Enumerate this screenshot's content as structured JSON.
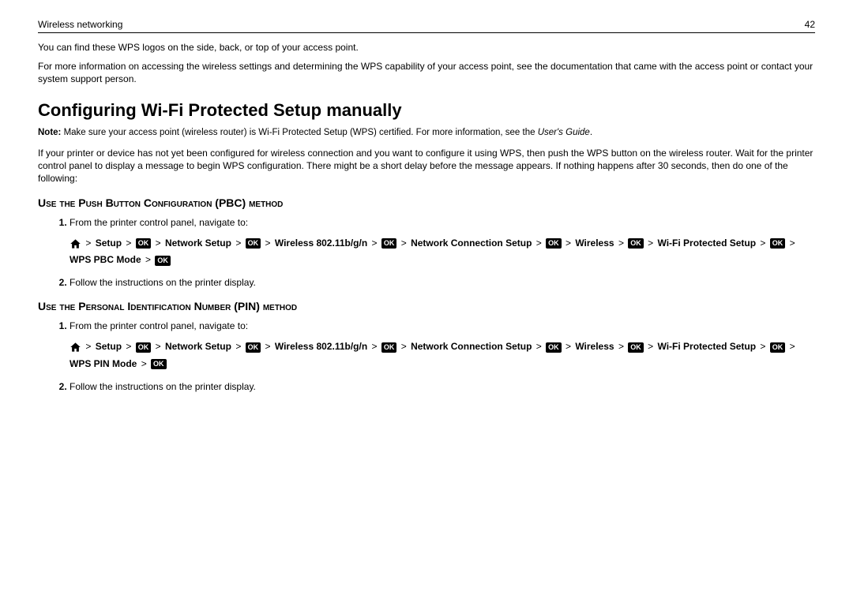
{
  "header": {
    "title": "Wireless networking",
    "page_number": "42"
  },
  "intro": {
    "line1": "You can find these WPS logos on the side, back, or top of your access point.",
    "line2": "For more information on accessing the wireless settings and determining the WPS capability of your access point, see the documentation that came with the access point or contact your system support person."
  },
  "main_heading": "Configuring Wi‑Fi Protected Setup manually",
  "note": {
    "label": "Note:",
    "body": " Make sure your access point (wireless router) is Wi‑Fi Protected Setup (WPS) certified. For more information, see the ",
    "italic": "User's Guide",
    "after": "."
  },
  "config_intro": "If your printer or device has not yet been configured for wireless connection and you want to configure it using WPS, then push the WPS button on the wireless router. Wait for the printer control panel to display a message to begin WPS configuration. There might be a short delay before the message appears. If nothing happens after 30 seconds, then do one of the following:",
  "pbc": {
    "head": "Use the Push Button Configuration (PBC) method",
    "step1_text": "From the printer control panel, navigate to:",
    "nav": {
      "setup": "Setup",
      "network_setup": "Network Setup",
      "wireless_band": "Wireless 802.11b/g/n",
      "network_connection_setup": "Network Connection Setup",
      "wireless": "Wireless",
      "wifi_protected": "Wi‑Fi Protected Setup",
      "mode": "WPS PBC Mode"
    },
    "step2_text": "Follow the instructions on the printer display."
  },
  "pin": {
    "head": "Use the Personal Identification Number (PIN) method",
    "step1_text": "From the printer control panel, navigate to:",
    "nav": {
      "setup": "Setup",
      "network_setup": "Network Setup",
      "wireless_band": "Wireless 802.11b/g/n",
      "network_connection_setup": "Network Connection Setup",
      "wireless": "Wireless",
      "wifi_protected": "Wi‑Fi Protected Setup",
      "mode": "WPS PIN Mode"
    },
    "step2_text": "Follow the instructions on the printer display."
  },
  "ok_label": "OK",
  "gt": ">"
}
